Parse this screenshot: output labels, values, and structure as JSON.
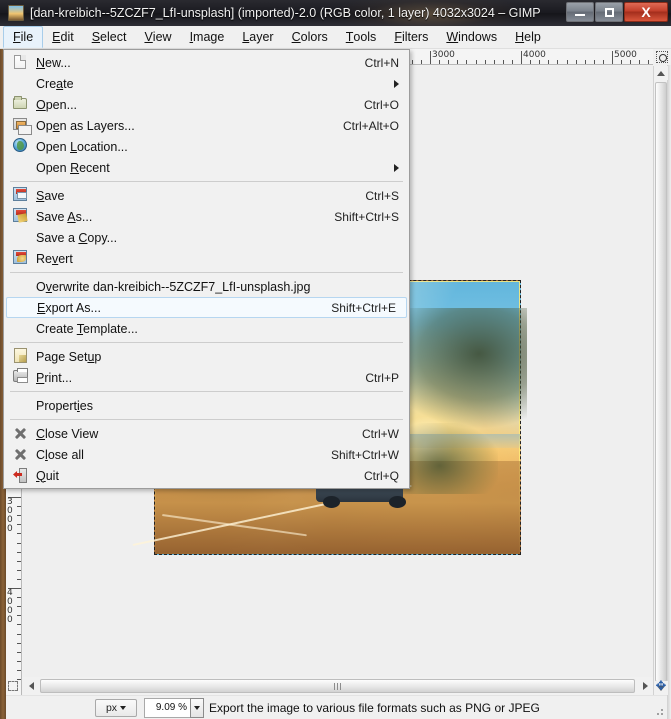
{
  "window": {
    "title": "[dan-kreibich--5ZCZF7_LfI-unsplash] (imported)-2.0 (RGB color, 1 layer) 4032x3024 – GIMP",
    "icon": "image-thumbnail-icon",
    "controls": {
      "minimize": "minimize-button",
      "maximize": "maximize-button",
      "close_label": "X"
    }
  },
  "menubar": {
    "items": [
      {
        "label": "File",
        "mnemonic": "F",
        "rest": "ile",
        "active": true
      },
      {
        "label": "Edit",
        "mnemonic": "E",
        "rest": "dit",
        "active": false
      },
      {
        "label": "Select",
        "mnemonic": "S",
        "rest": "elect",
        "active": false
      },
      {
        "label": "View",
        "mnemonic": "V",
        "rest": "iew",
        "active": false
      },
      {
        "label": "Image",
        "mnemonic": "I",
        "rest": "mage",
        "active": false
      },
      {
        "label": "Layer",
        "mnemonic": "L",
        "rest": "ayer",
        "active": false
      },
      {
        "label": "Colors",
        "mnemonic": "C",
        "rest": "olors",
        "active": false
      },
      {
        "label": "Tools",
        "mnemonic": "T",
        "rest": "ools",
        "active": false
      },
      {
        "label": "Filters",
        "mnemonic": "F",
        "rest": "ilters",
        "active": false
      },
      {
        "label": "Windows",
        "mnemonic": "W",
        "rest": "indows",
        "active": false
      },
      {
        "label": "Help",
        "mnemonic": "H",
        "rest": "elp",
        "active": false
      }
    ]
  },
  "file_menu": {
    "rows": [
      {
        "kind": "item",
        "icon": "new-document-icon",
        "label": "New...",
        "accel": "Ctrl+N",
        "submenu": false,
        "selected": false
      },
      {
        "kind": "item",
        "icon": "none",
        "label": "Create",
        "accel": "",
        "submenu": true,
        "selected": false
      },
      {
        "kind": "item",
        "icon": "open-folder-icon",
        "label": "Open...",
        "accel": "Ctrl+O",
        "submenu": false,
        "selected": false
      },
      {
        "kind": "item",
        "icon": "open-as-layers-icon",
        "label": "Open as Layers...",
        "accel": "Ctrl+Alt+O",
        "submenu": false,
        "selected": false
      },
      {
        "kind": "item",
        "icon": "globe-icon",
        "label": "Open Location...",
        "accel": "",
        "submenu": false,
        "selected": false
      },
      {
        "kind": "item",
        "icon": "none",
        "label": "Open Recent",
        "accel": "",
        "submenu": true,
        "selected": false
      },
      {
        "kind": "sep"
      },
      {
        "kind": "item",
        "icon": "save-icon",
        "label": "Save",
        "accel": "Ctrl+S",
        "submenu": false,
        "selected": false
      },
      {
        "kind": "item",
        "icon": "save-as-icon",
        "label": "Save As...",
        "accel": "Shift+Ctrl+S",
        "submenu": false,
        "selected": false
      },
      {
        "kind": "item",
        "icon": "none",
        "label": "Save a Copy...",
        "accel": "",
        "submenu": false,
        "selected": false
      },
      {
        "kind": "item",
        "icon": "revert-icon",
        "label": "Revert",
        "accel": "",
        "submenu": false,
        "selected": false
      },
      {
        "kind": "sep"
      },
      {
        "kind": "item",
        "icon": "none",
        "label": "Overwrite dan-kreibich--5ZCZF7_LfI-unsplash.jpg",
        "accel": "",
        "submenu": false,
        "selected": false
      },
      {
        "kind": "item",
        "icon": "none",
        "label": "Export As...",
        "accel": "Shift+Ctrl+E",
        "submenu": false,
        "selected": true
      },
      {
        "kind": "item",
        "icon": "none",
        "label": "Create Template...",
        "accel": "",
        "submenu": false,
        "selected": false
      },
      {
        "kind": "sep"
      },
      {
        "kind": "item",
        "icon": "page-setup-icon",
        "label": "Page Setup",
        "accel": "",
        "submenu": false,
        "selected": false
      },
      {
        "kind": "item",
        "icon": "print-icon",
        "label": "Print...",
        "accel": "Ctrl+P",
        "submenu": false,
        "selected": false
      },
      {
        "kind": "sep"
      },
      {
        "kind": "item",
        "icon": "none",
        "label": "Properties",
        "accel": "",
        "submenu": false,
        "selected": false
      },
      {
        "kind": "sep"
      },
      {
        "kind": "item",
        "icon": "close-x-icon",
        "label": "Close View",
        "accel": "Ctrl+W",
        "submenu": false,
        "selected": false
      },
      {
        "kind": "item",
        "icon": "close-x-icon",
        "label": "Close all",
        "accel": "Shift+Ctrl+W",
        "submenu": false,
        "selected": false
      },
      {
        "kind": "item",
        "icon": "quit-icon",
        "label": "Quit",
        "accel": "Ctrl+Q",
        "submenu": false,
        "selected": false
      }
    ]
  },
  "rulers": {
    "horizontal_labels": [
      "3000",
      "4000",
      "5000"
    ],
    "vertical_labels": [
      "3000",
      "4000"
    ]
  },
  "canvas": {
    "selection": "marching-ants-dashed-border",
    "image_alt": "sunset coastal road with car and trees"
  },
  "statusbar": {
    "unit": "px",
    "zoom": "9.09 %",
    "message": "Export the image to various file formats such as PNG or JPEG"
  },
  "colors": {
    "accent": "#b6d6f0",
    "menu_bg": "#f1f1f1",
    "titlebar": "#1a1a20",
    "close_button": "#c23f2b",
    "selection_yellow": "#ffe873"
  }
}
